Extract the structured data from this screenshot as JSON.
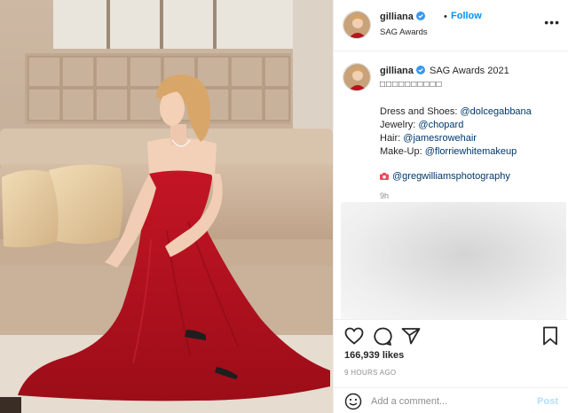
{
  "header": {
    "username": "gilliana",
    "separator": "•",
    "follow_label": "Follow",
    "location": "SAG Awards",
    "more_label": "•••"
  },
  "caption": {
    "username": "gilliana",
    "title": "SAG Awards 2021",
    "emoji_line": "□□□□□□□□□□",
    "lines": [
      {
        "label": "Dress and Shoes: ",
        "tag": "@dolcegabbana"
      },
      {
        "label": "Jewelry: ",
        "tag": "@chopard"
      },
      {
        "label": "Hair: ",
        "tag": "@jamesrowehair"
      },
      {
        "label": "Make-Up: ",
        "tag": "@florriewhitemakeup"
      }
    ],
    "photographer_tag": "@gregwilliamsphotography",
    "time": "9h"
  },
  "actions": {
    "icons": [
      "heart-icon",
      "comment-icon",
      "share-icon",
      "bookmark-icon"
    ],
    "likes": "166,939 likes",
    "time_ago": "9 HOURS AGO"
  },
  "comment_box": {
    "placeholder": "Add a comment...",
    "post_label": "Post"
  },
  "colors": {
    "link_blue": "#0095f6",
    "tag_navy": "#00376b",
    "muted": "#8e8e8e",
    "post_disabled": "#b2dffc",
    "dress_red": "#b3121f"
  }
}
